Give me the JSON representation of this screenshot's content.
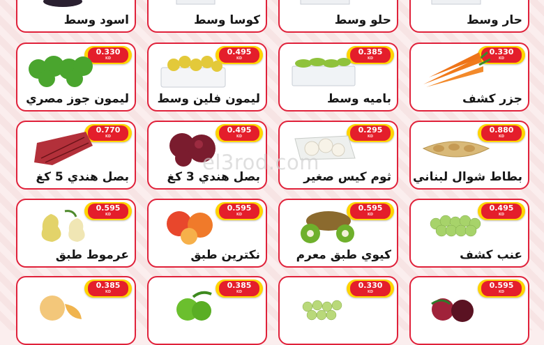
{
  "watermark": "el3rod.com",
  "currency": "KD",
  "products": [
    {
      "name": "حار وسط",
      "price": ""
    },
    {
      "name": "حلو وسط",
      "price": ""
    },
    {
      "name": "كوسا وسط",
      "price": ""
    },
    {
      "name": "اسود وسط",
      "price": ""
    },
    {
      "name": "جزر كشف",
      "price": "0.330",
      "icon": "carrot-icon"
    },
    {
      "name": "باميه وسط",
      "price": "0.385",
      "icon": "okra-icon"
    },
    {
      "name": "ليمون فلين وسط",
      "price": "0.495",
      "icon": "lemon-icon"
    },
    {
      "name": "ليمون جوز مصري",
      "price": "0.330",
      "icon": "green-lemon-icon"
    },
    {
      "name": "بطاط شوال لبناني",
      "price": "0.880",
      "icon": "potato-icon"
    },
    {
      "name": "ثوم كيس صغير",
      "price": "0.295",
      "icon": "garlic-icon"
    },
    {
      "name": "بصل هندي 3 كغ",
      "price": "0.495",
      "icon": "onion-icon"
    },
    {
      "name": "بصل هندي 5 كغ",
      "price": "0.770",
      "icon": "onion-bag-icon"
    },
    {
      "name": "عنب كشف",
      "price": "0.495",
      "icon": "grapes-icon"
    },
    {
      "name": "كيوي طبق معرم",
      "price": "0.595",
      "icon": "kiwi-icon"
    },
    {
      "name": "نكترين طبق",
      "price": "0.595",
      "icon": "nectarine-icon"
    },
    {
      "name": "عرموط طبق",
      "price": "0.595",
      "icon": "pear-icon"
    },
    {
      "name": "",
      "price": "0.595",
      "icon": "plum-icon"
    },
    {
      "name": "",
      "price": "0.330",
      "icon": "green-grapes-icon"
    },
    {
      "name": "",
      "price": "0.385",
      "icon": "green-apple-icon"
    },
    {
      "name": "",
      "price": "0.385",
      "icon": "melon-icon"
    }
  ]
}
